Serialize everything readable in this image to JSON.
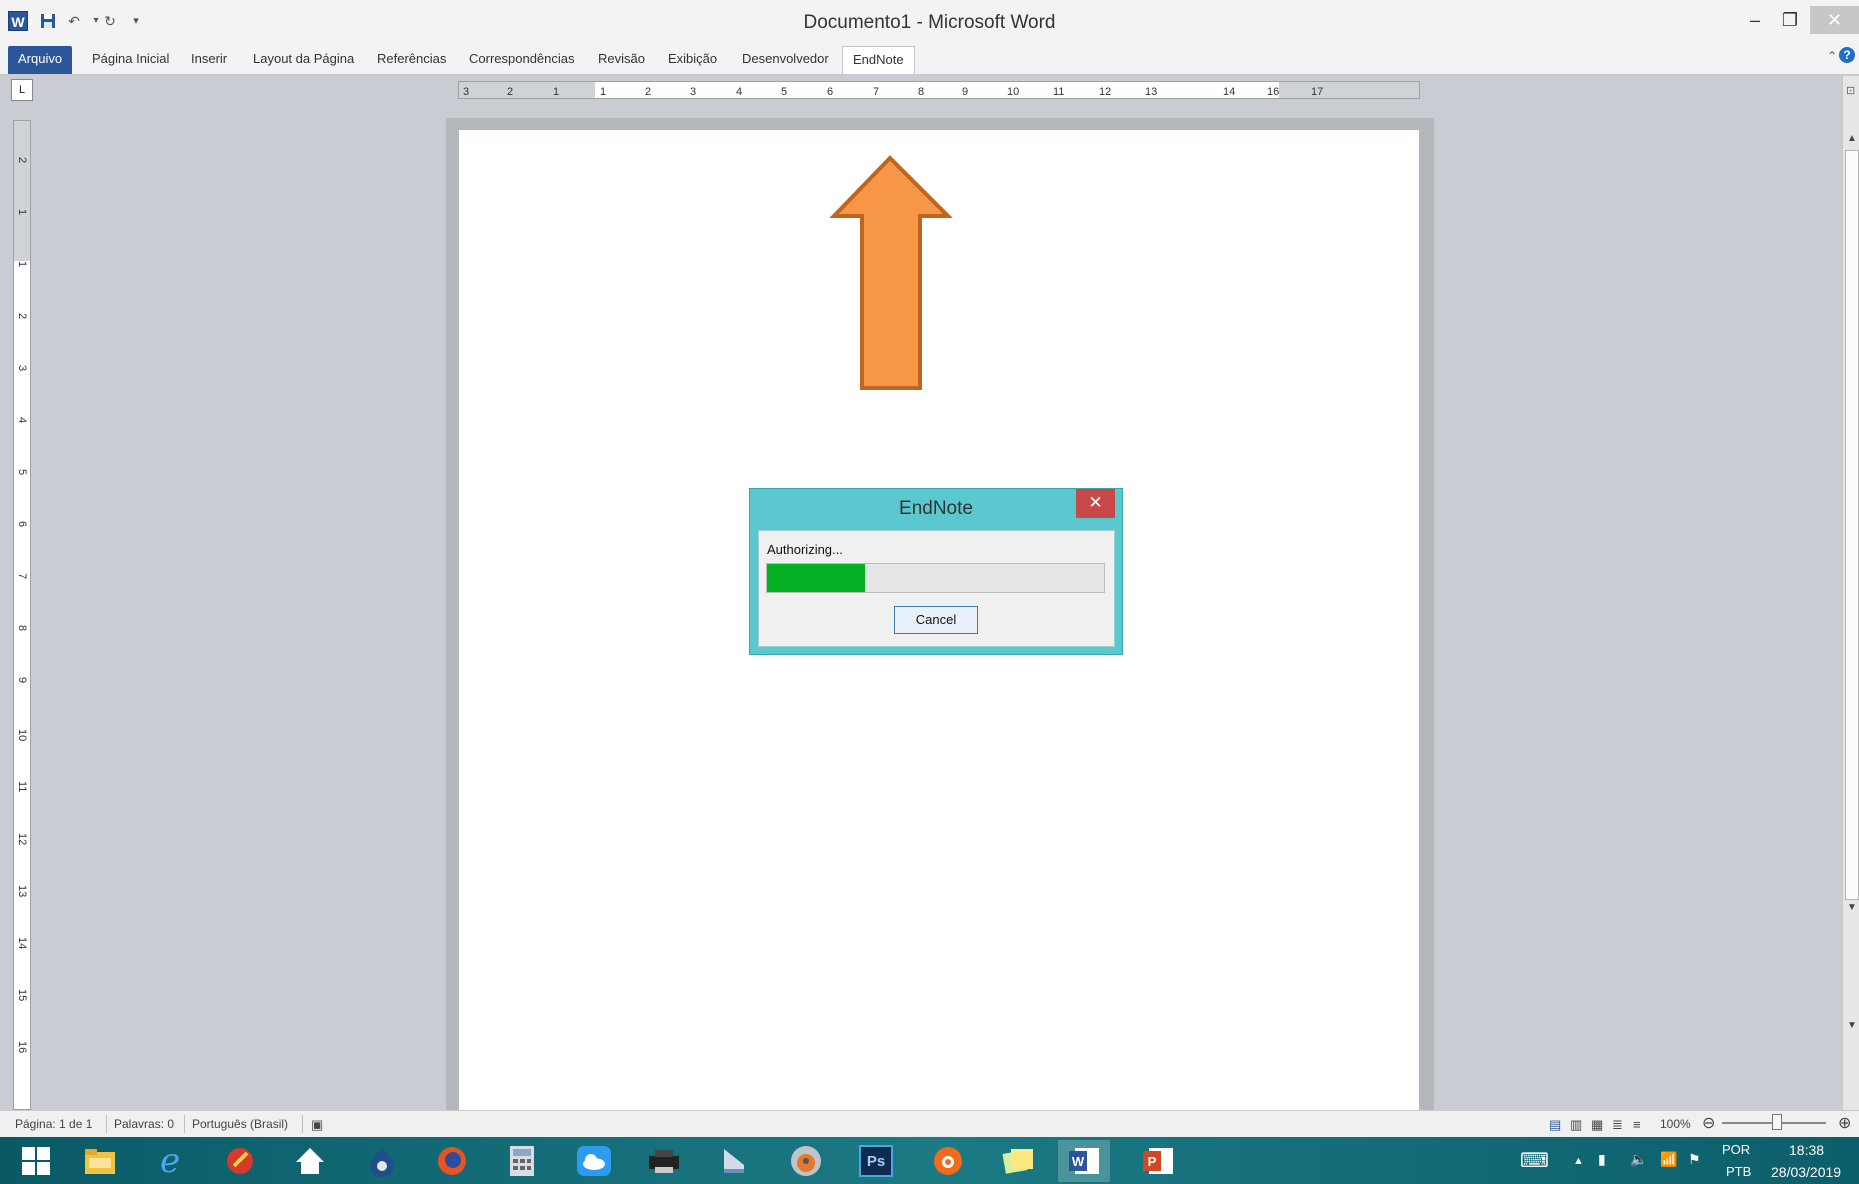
{
  "window": {
    "title": "Documento1  -  Microsoft Word",
    "app_icon_letter": "W",
    "quick_access": [
      "save-icon",
      "undo-icon",
      "redo-icon",
      "customize-icon"
    ],
    "controls": [
      "minimize-icon",
      "restore-icon",
      "close-icon"
    ]
  },
  "ribbon": {
    "tabs": [
      "Arquivo",
      "Página Inicial",
      "Inserir",
      "Layout da Página",
      "Referências",
      "Correspondências",
      "Revisão",
      "Exibição",
      "Desenvolvedor",
      "EndNote"
    ],
    "active_tab": "EndNote",
    "file_tab_color": "#2b579a"
  },
  "rulers": {
    "selector_glyph": "L",
    "horizontal_labels": [
      "3",
      "2",
      "1",
      "1",
      "2",
      "3",
      "4",
      "5",
      "6",
      "7",
      "8",
      "9",
      "10",
      "11",
      "12",
      "13",
      "14",
      "16",
      "17"
    ],
    "vertical_labels": [
      "2",
      "1",
      "1",
      "2",
      "3",
      "4",
      "5",
      "6",
      "7",
      "8",
      "9",
      "10",
      "11",
      "12",
      "13",
      "14",
      "15",
      "16"
    ]
  },
  "annotation_arrow": {
    "color": "#f79646",
    "outline": "#c0651f",
    "direction": "up"
  },
  "dialog": {
    "title": "EndNote",
    "status": "Authorizing...",
    "progress": 0.29,
    "progress_color": "#06b025",
    "cancel_label": "Cancel",
    "title_bar_color": "#5bc8d0",
    "close_color": "#c74848"
  },
  "statusbar": {
    "page": "Página: 1 de 1",
    "words": "Palavras: 0",
    "language": "Português (Brasil)",
    "zoom": "100%"
  },
  "taskbar": {
    "apps": [
      "windows-start",
      "file-explorer",
      "internet-explorer",
      "ccleaner",
      "home",
      "app-drop",
      "firefox",
      "calculator",
      "icloud",
      "printer",
      "scanner",
      "disc-burner",
      "photoshop",
      "avast",
      "sticky-notes",
      "word",
      "powerpoint"
    ],
    "photoshop_label": "Ps",
    "active_app": "word",
    "language_top": "POR",
    "language_bottom": "PTB",
    "time": "18:38",
    "date": "28/03/2019"
  }
}
